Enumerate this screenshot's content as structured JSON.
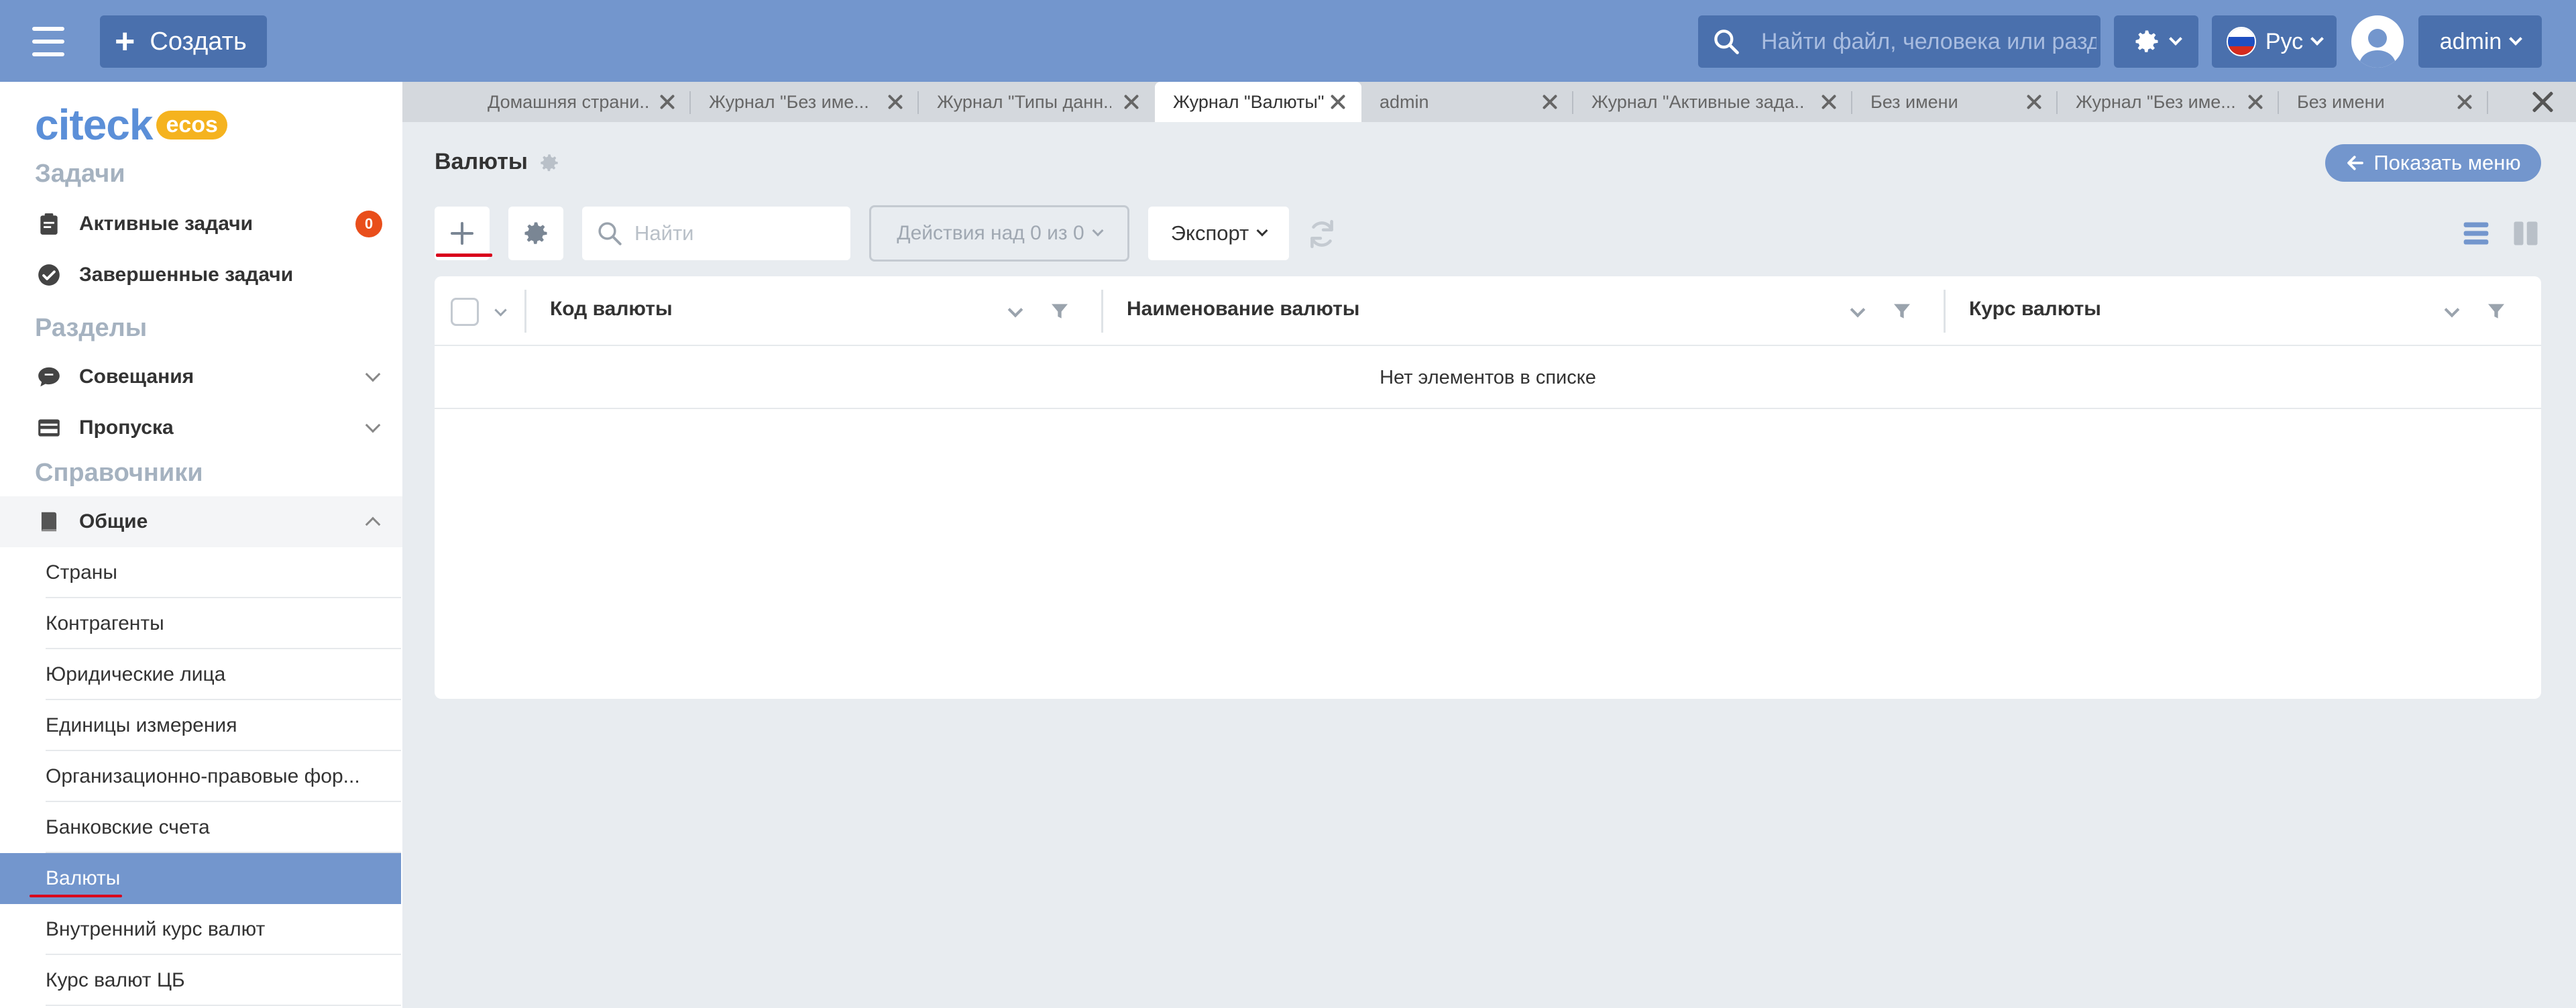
{
  "header": {
    "create_label": "Создать",
    "search_placeholder": "Найти файл, человека или раздел",
    "language": "Рус",
    "user": "admin"
  },
  "sidebar": {
    "logo_text": "citeck",
    "logo_badge": "ecos",
    "sections": {
      "tasks": "Задачи",
      "sections": "Разделы",
      "references": "Справочники"
    },
    "tasks": [
      {
        "label": "Активные задачи",
        "badge": "0"
      },
      {
        "label": "Завершенные задачи"
      }
    ],
    "section_items": [
      {
        "label": "Совещания"
      },
      {
        "label": "Пропуска"
      }
    ],
    "group": {
      "label": "Общие"
    },
    "sub_items": [
      {
        "label": "Страны"
      },
      {
        "label": "Контрагенты"
      },
      {
        "label": "Юридические лица"
      },
      {
        "label": "Единицы измерения"
      },
      {
        "label": "Организационно-правовые фор..."
      },
      {
        "label": "Банковские счета"
      },
      {
        "label": "Валюты"
      },
      {
        "label": "Внутренний курс валют"
      },
      {
        "label": "Курс валют ЦБ"
      }
    ]
  },
  "tabs": [
    {
      "label": "Домашняя страни..."
    },
    {
      "label": "Журнал \"Без име..."
    },
    {
      "label": "Журнал \"Типы данн..."
    },
    {
      "label": "Журнал \"Валюты\""
    },
    {
      "label": "admin"
    },
    {
      "label": "Журнал \"Активные зада..."
    },
    {
      "label": "Без имени"
    },
    {
      "label": "Журнал \"Без име..."
    },
    {
      "label": "Без имени"
    }
  ],
  "main": {
    "title": "Валюты",
    "show_menu": "Показать меню",
    "search_placeholder": "Найти",
    "actions_label": "Действия над 0 из 0",
    "export_label": "Экспорт",
    "columns": [
      {
        "label": "Код валюты"
      },
      {
        "label": "Наименование валюты"
      },
      {
        "label": "Курс валюты"
      }
    ],
    "empty_text": "Нет элементов в списке"
  },
  "colors": {
    "header_bg": "#7396cd",
    "header_btn": "#4a70ad",
    "active_item": "#7396cd",
    "badge": "#e94e1b",
    "underline_red": "#d9001b"
  }
}
